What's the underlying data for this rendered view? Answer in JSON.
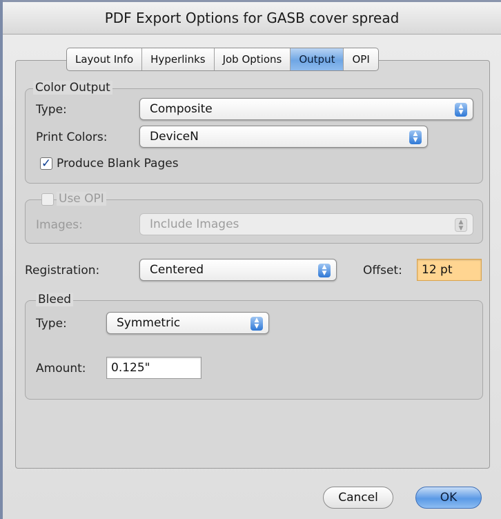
{
  "window": {
    "title": "PDF Export Options for GASB cover spread"
  },
  "tabs": [
    {
      "label": "Layout Info"
    },
    {
      "label": "Hyperlinks"
    },
    {
      "label": "Job Options"
    },
    {
      "label": "Output",
      "active": true
    },
    {
      "label": "OPI"
    }
  ],
  "color_output": {
    "legend": "Color Output",
    "type_label": "Type:",
    "type_value": "Composite",
    "print_colors_label": "Print Colors:",
    "print_colors_value": "DeviceN",
    "produce_blank_label": "Produce Blank Pages",
    "produce_blank_checked": true
  },
  "opi": {
    "legend": "Use OPI",
    "checked": false,
    "images_label": "Images:",
    "images_value": "Include Images"
  },
  "registration": {
    "label": "Registration:",
    "value": "Centered",
    "offset_label": "Offset:",
    "offset_value": "12 pt"
  },
  "bleed": {
    "legend": "Bleed",
    "type_label": "Type:",
    "type_value": "Symmetric",
    "amount_label": "Amount:",
    "amount_value": "0.125\""
  },
  "buttons": {
    "cancel": "Cancel",
    "ok": "OK"
  },
  "colors": {
    "active_tab": "#7aaee8",
    "ok_button": "#5b9ae6",
    "offset_highlight": "#ffd591"
  }
}
